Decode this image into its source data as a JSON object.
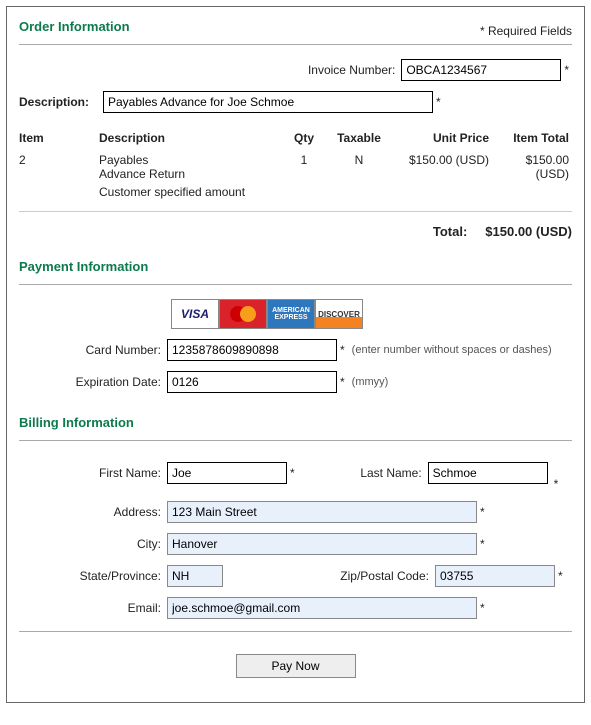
{
  "order": {
    "header": "Order Information",
    "required_fields": "* Required Fields",
    "invoice_label": "Invoice Number:",
    "invoice_value": "OBCA1234567",
    "description_label": "Description:",
    "description_value": "Payables Advance for Joe Schmoe",
    "columns": {
      "item": "Item",
      "desc": "Description",
      "qty": "Qty",
      "taxable": "Taxable",
      "unit_price": "Unit Price",
      "item_total": "Item Total"
    },
    "row": {
      "item": "2",
      "desc_line1": "Payables",
      "desc_line2": "Advance Return",
      "desc_line3": "Customer specified amount",
      "qty": "1",
      "taxable": "N",
      "unit_price": "$150.00 (USD)",
      "item_total": "$150.00 (USD)"
    },
    "total_label": "Total:",
    "total_value": "$150.00 (USD)"
  },
  "payment": {
    "header": "Payment Information",
    "card_number_label": "Card Number:",
    "card_number_value": "1235878609890898",
    "card_number_hint": "(enter number without spaces or dashes)",
    "exp_label": "Expiration Date:",
    "exp_value": "0126",
    "exp_hint": "(mmyy)",
    "logos": {
      "visa": "VISA",
      "mc": "MasterCard",
      "amex": "AMERICAN EXPRESS",
      "disc": "DISCOVER"
    }
  },
  "billing": {
    "header": "Billing Information",
    "first_name_label": "First Name:",
    "first_name_value": "Joe",
    "last_name_label": "Last Name:",
    "last_name_value": "Schmoe",
    "address_label": "Address:",
    "address_value": "123 Main Street",
    "city_label": "City:",
    "city_value": "Hanover",
    "state_label": "State/Province:",
    "state_value": "NH",
    "zip_label": "Zip/Postal Code:",
    "zip_value": "03755",
    "email_label": "Email:",
    "email_value": "joe.schmoe@gmail.com"
  },
  "pay_now": "Pay Now"
}
